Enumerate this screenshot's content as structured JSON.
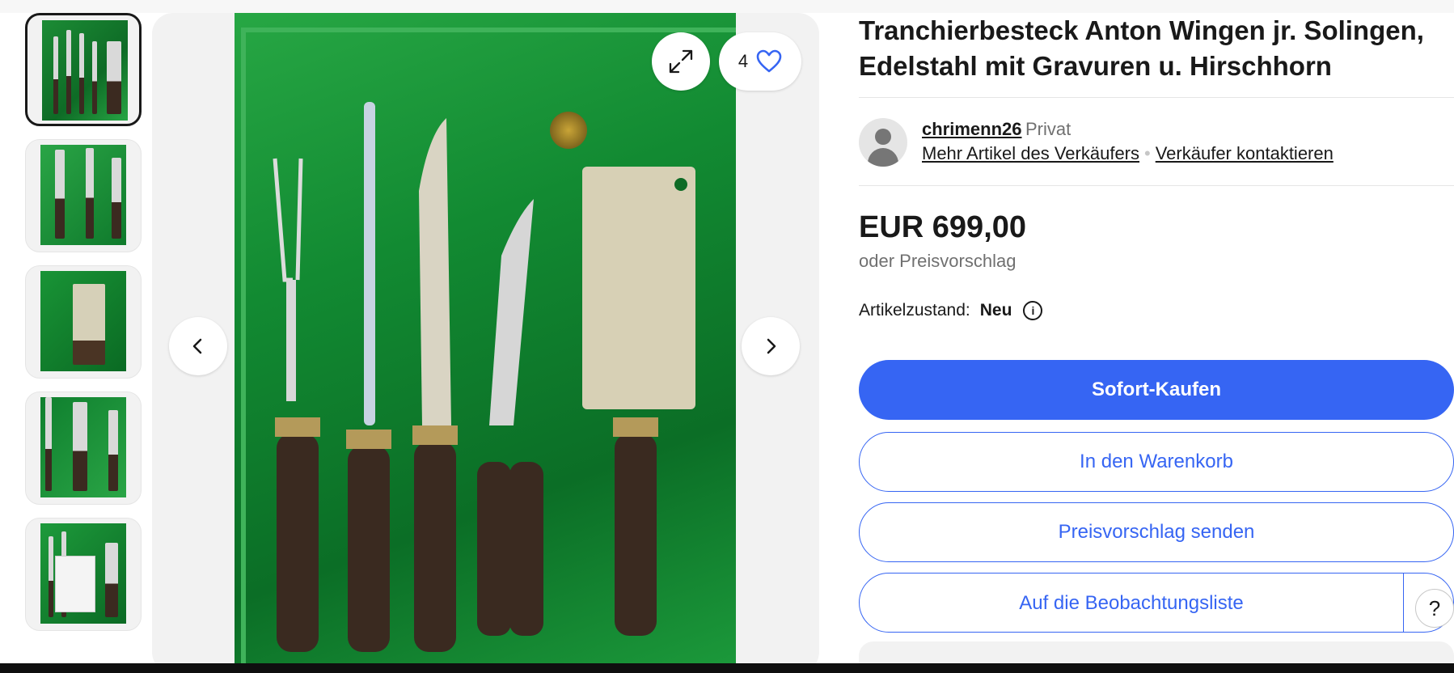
{
  "gallery": {
    "favorite_count": "4",
    "icons": {
      "expand": "expand-icon",
      "heart": "heart-icon",
      "prev": "chevron-left-icon",
      "next": "chevron-right-icon"
    },
    "thumbnail_count": 5,
    "selected_thumbnail": 1
  },
  "listing": {
    "title": "Tranchierbesteck Anton Wingen jr. Solingen, Edelstahl mit Gravuren u. Hirschhorn",
    "price": "EUR 699,00",
    "offer_text": "oder Preisvorschlag",
    "condition_label": "Artikelzustand:",
    "condition_value": "Neu"
  },
  "seller": {
    "name": "chrimenn26",
    "type": "Privat",
    "more_items": "Mehr Artikel des Verkäufers",
    "contact": "Verkäufer kontaktieren"
  },
  "actions": {
    "buy_now": "Sofort-Kaufen",
    "add_to_cart": "In den Warenkorb",
    "make_offer": "Preisvorschlag senden",
    "watchlist": "Auf die Beobachtungsliste"
  },
  "help": {
    "label": "?"
  },
  "colors": {
    "primary": "#3665f3",
    "text": "#191919",
    "muted": "#707070"
  }
}
